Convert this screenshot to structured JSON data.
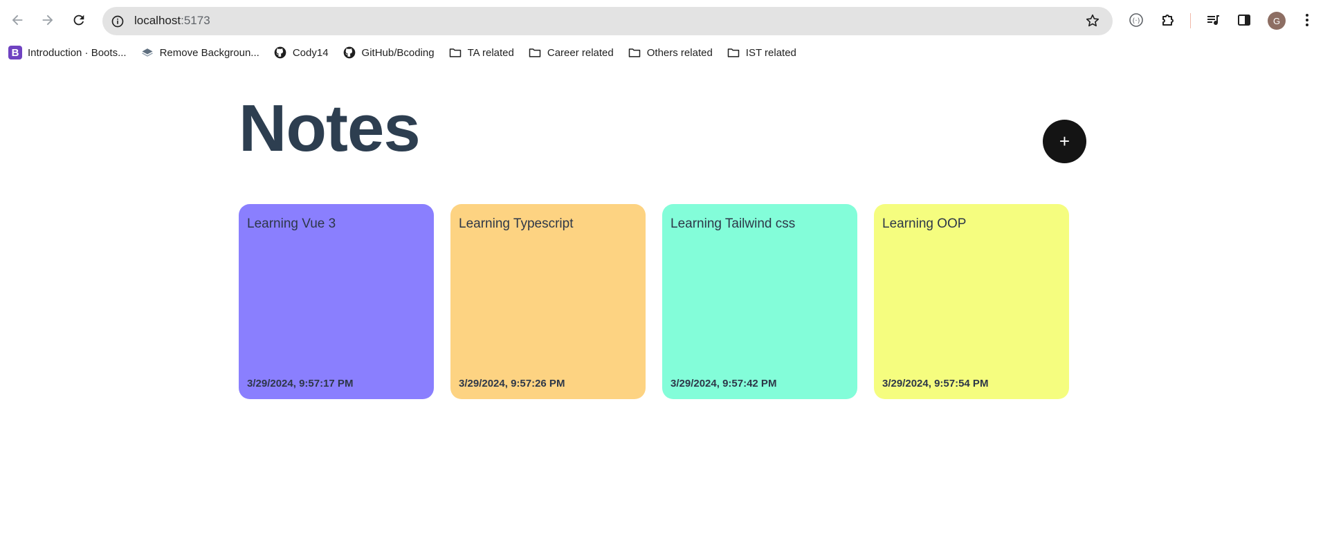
{
  "browser": {
    "url_host": "localhost",
    "url_port": ":5173",
    "avatar_letter": "G",
    "icons": [
      "back-arrow-icon",
      "forward-arrow-icon",
      "reload-icon",
      "info-icon",
      "star-icon",
      "media-router-icon",
      "extensions-icon",
      "media-controls-icon",
      "side-panel-icon",
      "menu-dots-icon"
    ]
  },
  "bookmarks": [
    {
      "label": "Introduction · Boots...",
      "icon": "bootstrap-icon"
    },
    {
      "label": "Remove Backgroun...",
      "icon": "layers-icon"
    },
    {
      "label": "Cody14",
      "icon": "github-icon"
    },
    {
      "label": "GitHub/Bcoding",
      "icon": "github-icon"
    },
    {
      "label": "TA related",
      "icon": "folder-icon"
    },
    {
      "label": "Career related",
      "icon": "folder-icon"
    },
    {
      "label": "Others related",
      "icon": "folder-icon"
    },
    {
      "label": "IST related",
      "icon": "folder-icon"
    }
  ],
  "app": {
    "title": "Notes",
    "add_label": "+",
    "notes": [
      {
        "title": "Learning Vue 3",
        "date": "3/29/2024, 9:57:17 PM",
        "color": "#8a7ffe"
      },
      {
        "title": "Learning Typescript",
        "date": "3/29/2024, 9:57:26 PM",
        "color": "#fdd382"
      },
      {
        "title": "Learning Tailwind css",
        "date": "3/29/2024, 9:57:42 PM",
        "color": "#83fdd9"
      },
      {
        "title": "Learning OOP",
        "date": "3/29/2024, 9:57:54 PM",
        "color": "#f5fd7f"
      }
    ]
  }
}
